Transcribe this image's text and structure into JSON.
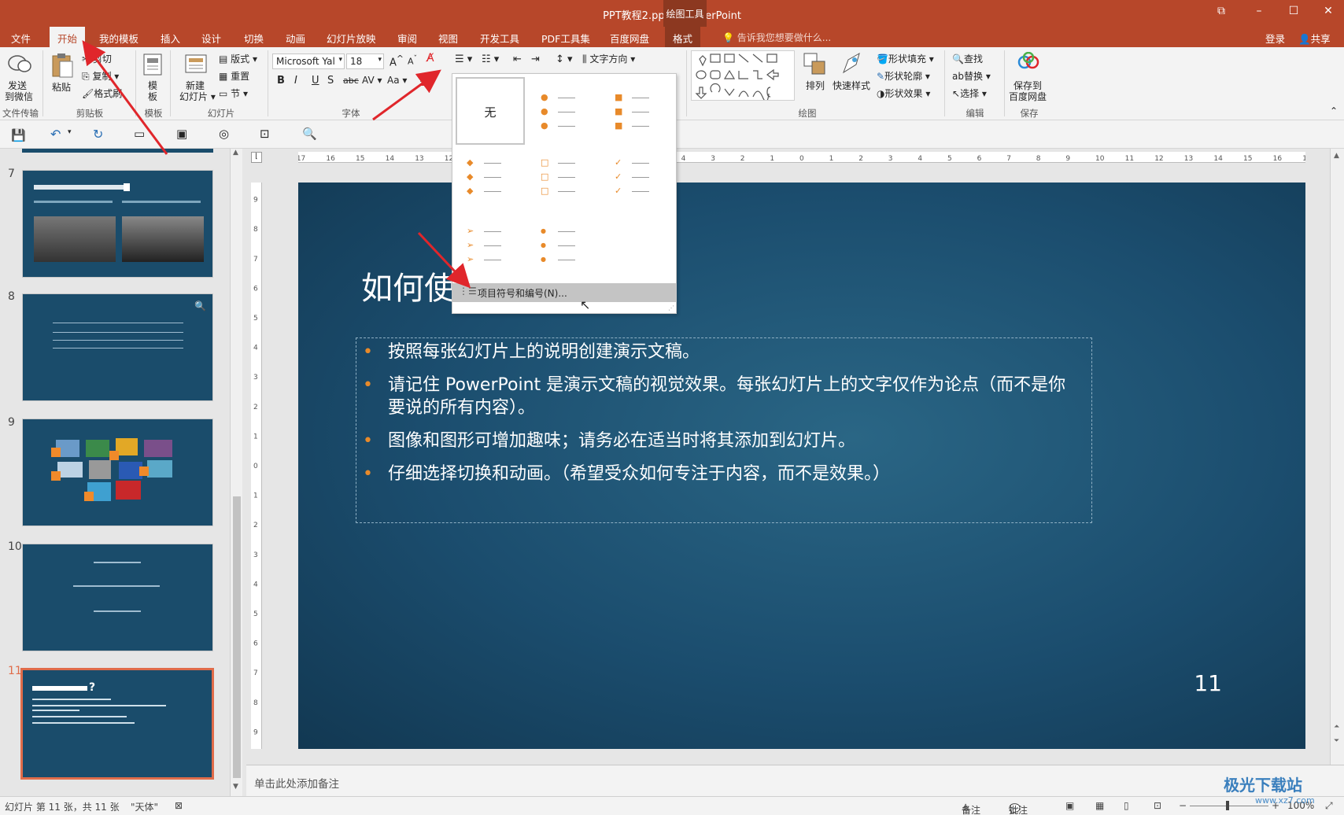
{
  "window": {
    "title": "PPT教程2.pptx - PowerPoint",
    "context_tab_header": "绘图工具",
    "controls": [
      "restore-icon",
      "minimize-icon",
      "maximize-icon",
      "close-icon"
    ]
  },
  "tabs": [
    "文件",
    "开始",
    "我的模板",
    "插入",
    "设计",
    "切换",
    "动画",
    "幻灯片放映",
    "审阅",
    "视图",
    "开发工具",
    "PDF工具集",
    "百度网盘",
    "格式"
  ],
  "active_tab": "开始",
  "tell_me": "告诉我您想要做什么...",
  "account": {
    "login": "登录",
    "share": "共享"
  },
  "ribbon": {
    "send_wechat": "发送\n到微信",
    "send_wechat_line1": "发送",
    "send_wechat_line2": "到微信",
    "paste": "粘贴",
    "cut": "剪切",
    "copy": "复制",
    "format_painter": "格式刷",
    "template": "模",
    "template2": "板",
    "new_slide_line1": "新建",
    "new_slide_line2": "幻灯片",
    "layout": "版式",
    "reset": "重置",
    "section": "节",
    "font_name": "Microsoft Yal",
    "font_size": "18",
    "text_direction": "文字方向",
    "arrange": "排列",
    "quick_styles": "快速样式",
    "shape_fill": "形状填充",
    "shape_outline": "形状轮廓",
    "shape_effects": "形状效果",
    "find": "查找",
    "replace": "替换",
    "select": "选择",
    "save_baidu_line1": "保存到",
    "save_baidu_line2": "百度网盘",
    "groups": {
      "file_transfer": "文件传输",
      "clipboard": "剪贴板",
      "templates": "模板",
      "slides": "幻灯片",
      "font": "字体",
      "drawing": "绘图",
      "editing": "编辑",
      "save": "保存"
    }
  },
  "bullet_dropdown": {
    "none_label": "无",
    "footer_label": "项目符号和编号(N)..."
  },
  "thumbnails": [
    {
      "number": "7"
    },
    {
      "number": "8"
    },
    {
      "number": "9"
    },
    {
      "number": "10"
    },
    {
      "number": "11",
      "selected": true
    }
  ],
  "slide": {
    "title": "如何使",
    "bullets": [
      "按照每张幻灯片上的说明创建演示文稿。",
      "请记住 PowerPoint 是演示文稿的视觉效果。每张幻灯片上的文字仅作为论点（而不是你要说的所有内容）。",
      "图像和图形可增加趣味；请务必在适当时将其添加到幻灯片。",
      "仔细选择切换和动画。（希望受众如何专注于内容，而不是效果。）"
    ],
    "number": "11"
  },
  "notes_placeholder": "单击此处添加备注",
  "status_bar": {
    "slide_info": "幻灯片 第 11 张，共 11 张",
    "theme": "\"天体\"",
    "notes": "备注",
    "comments": "批注",
    "zoom": "100%"
  },
  "watermark": {
    "name": "极光下载站",
    "url": "www.xz7.com"
  },
  "colors": {
    "accent": "#b7472a",
    "bullet": "#e88a2a",
    "slide_bg": "#1b4d6e",
    "annotation_arrow": "#e0262b"
  }
}
